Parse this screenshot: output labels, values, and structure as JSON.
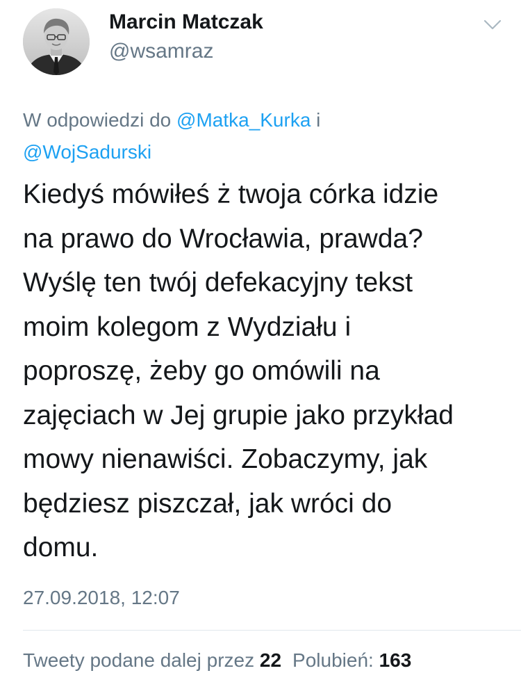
{
  "author": {
    "display_name": "Marcin Matczak",
    "handle": "@wsamraz",
    "avatar_icon": "profile-photo-icon"
  },
  "menu": {
    "icon": "chevron-down-icon"
  },
  "reply": {
    "prefix": "W odpowiedzi do ",
    "mention1": "@Matka_Kurka",
    "joiner": " i",
    "mention2": "@WojSadurski"
  },
  "tweet": {
    "lines": [
      "Kiedyś mówiłeś ż twoja córka idzie",
      "na prawo do Wrocławia, prawda?",
      "Wyślę ten twój defekacyjny tekst",
      "moim kolegom z Wydziału i",
      "poproszę, żeby go omówili na",
      "zajęciach w Jej grupie jako przykład",
      "mowy nienawiści. Zobaczymy, jak",
      "będziesz piszczał, jak wróci do",
      "domu."
    ],
    "timestamp": "27.09.2018, 12:07"
  },
  "stats": {
    "retweets_label": "Tweety podane dalej przez",
    "retweets_count": "22",
    "likes_label": "Polubień:",
    "likes_count": "163"
  },
  "colors": {
    "text": "#14171a",
    "secondary": "#657786",
    "link": "#1da1f2",
    "divider": "#e1e8ed"
  }
}
